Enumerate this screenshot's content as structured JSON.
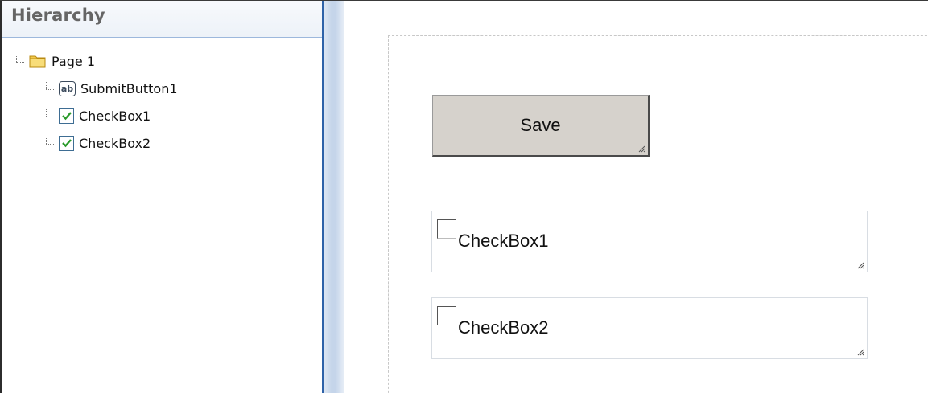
{
  "hierarchy": {
    "title": "Hierarchy",
    "root": {
      "label": "Page 1",
      "icon": "folder-icon"
    },
    "children": [
      {
        "label": "SubmitButton1",
        "icon": "text-button-icon"
      },
      {
        "label": "CheckBox1",
        "icon": "checkbox-checked-icon"
      },
      {
        "label": "CheckBox2",
        "icon": "checkbox-checked-icon"
      }
    ]
  },
  "canvas": {
    "save_button": {
      "label": "Save"
    },
    "checkbox1": {
      "label": "CheckBox1",
      "checked": false
    },
    "checkbox2": {
      "label": "CheckBox2",
      "checked": false
    }
  },
  "colors": {
    "panel_border": "#2f63a8",
    "splitter": "#c5d5ea",
    "button_face": "#d6d2cc",
    "check_green": "#2a9a2a",
    "folder_yellow": "#f2c94c"
  }
}
